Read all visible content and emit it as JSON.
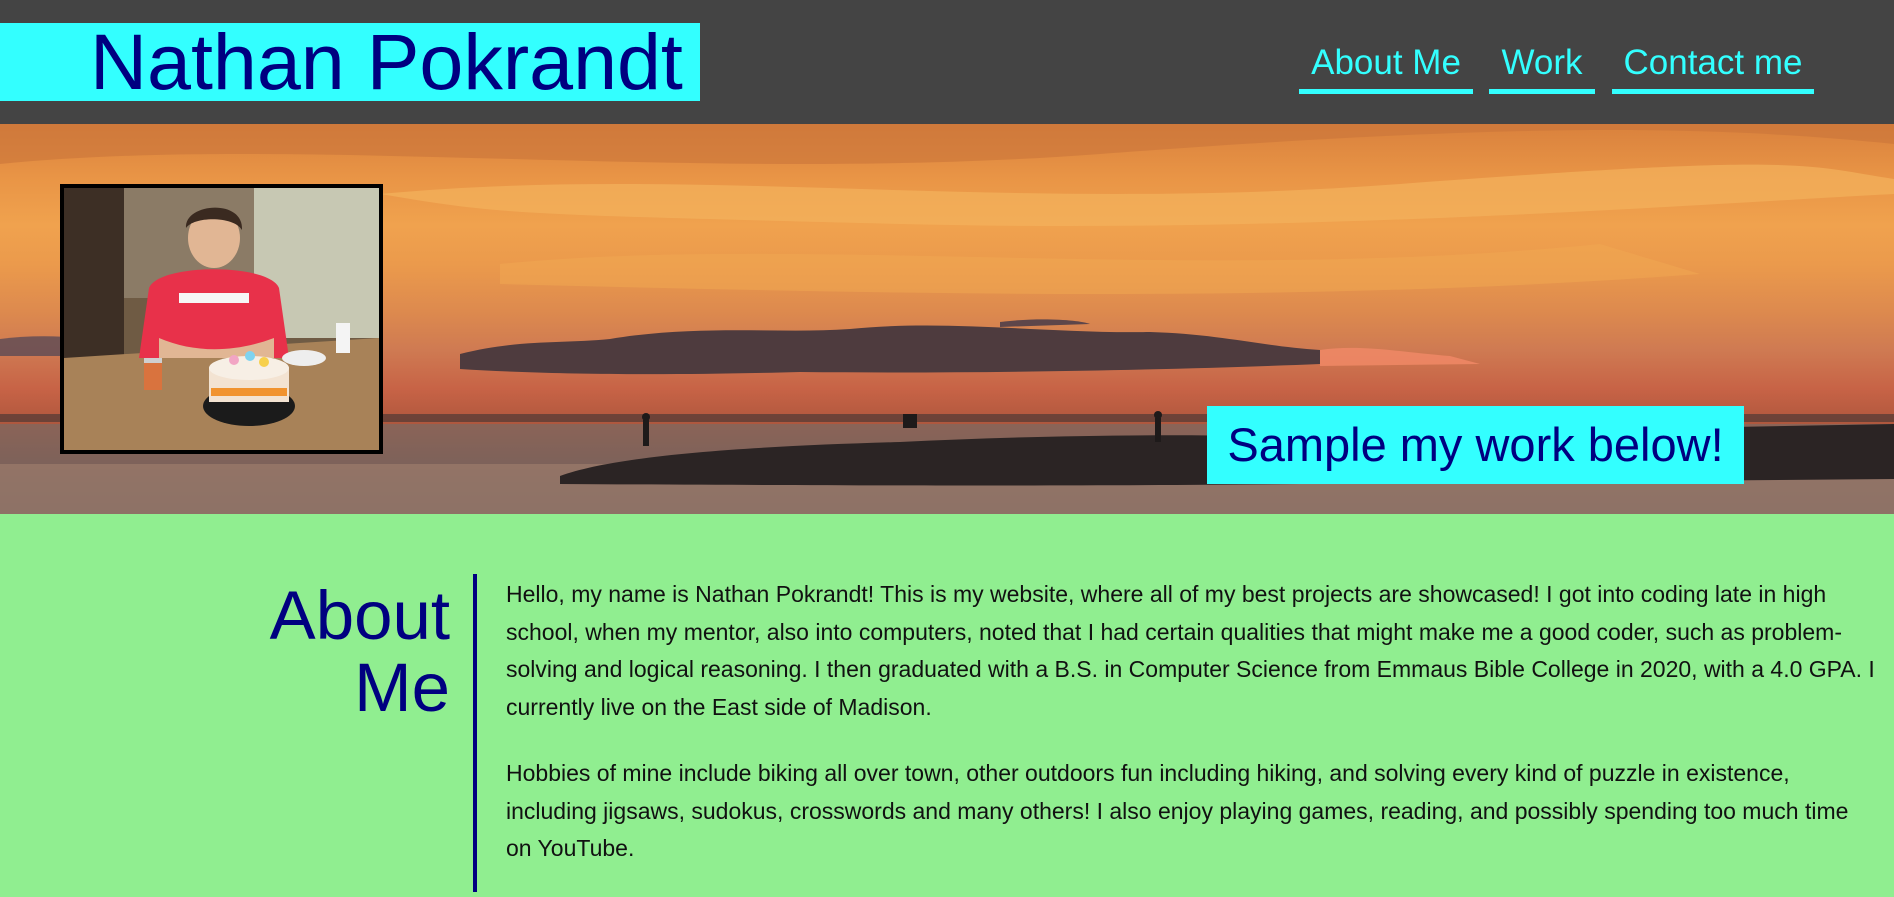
{
  "header": {
    "site_name": "Nathan Pokrandt",
    "nav": [
      {
        "label": "About Me"
      },
      {
        "label": "Work"
      },
      {
        "label": "Contact me"
      }
    ]
  },
  "hero": {
    "tagline": "Sample my work below!",
    "image": "sunset-over-lake-photo",
    "profile_photo": "profile-photo-birthday-cake"
  },
  "about": {
    "heading_line1": "About",
    "heading_line2": "Me",
    "paragraphs": [
      "Hello, my name is Nathan Pokrandt! This is my website, where all of my best projects are showcased! I got into coding late in high school, when my mentor, also into computers, noted that I had certain qualities that might make me a good coder, such as problem-solving and logical reasoning. I then graduated with a B.S. in Computer Science from Emmaus Bible College in 2020, with a 4.0 GPA. I currently live on the East side of Madison.",
      "Hobbies of mine include biking all over town, other outdoors fun including hiking, and solving every kind of puzzle in existence, including jigsaws, sudokus, crosswords and many others! I also enjoy playing games, reading, and possibly spending too much time on YouTube."
    ]
  },
  "colors": {
    "header_bg": "#444444",
    "accent_cyan": "#33ffff",
    "text_navy": "#000080",
    "page_bg": "#90ee90"
  }
}
